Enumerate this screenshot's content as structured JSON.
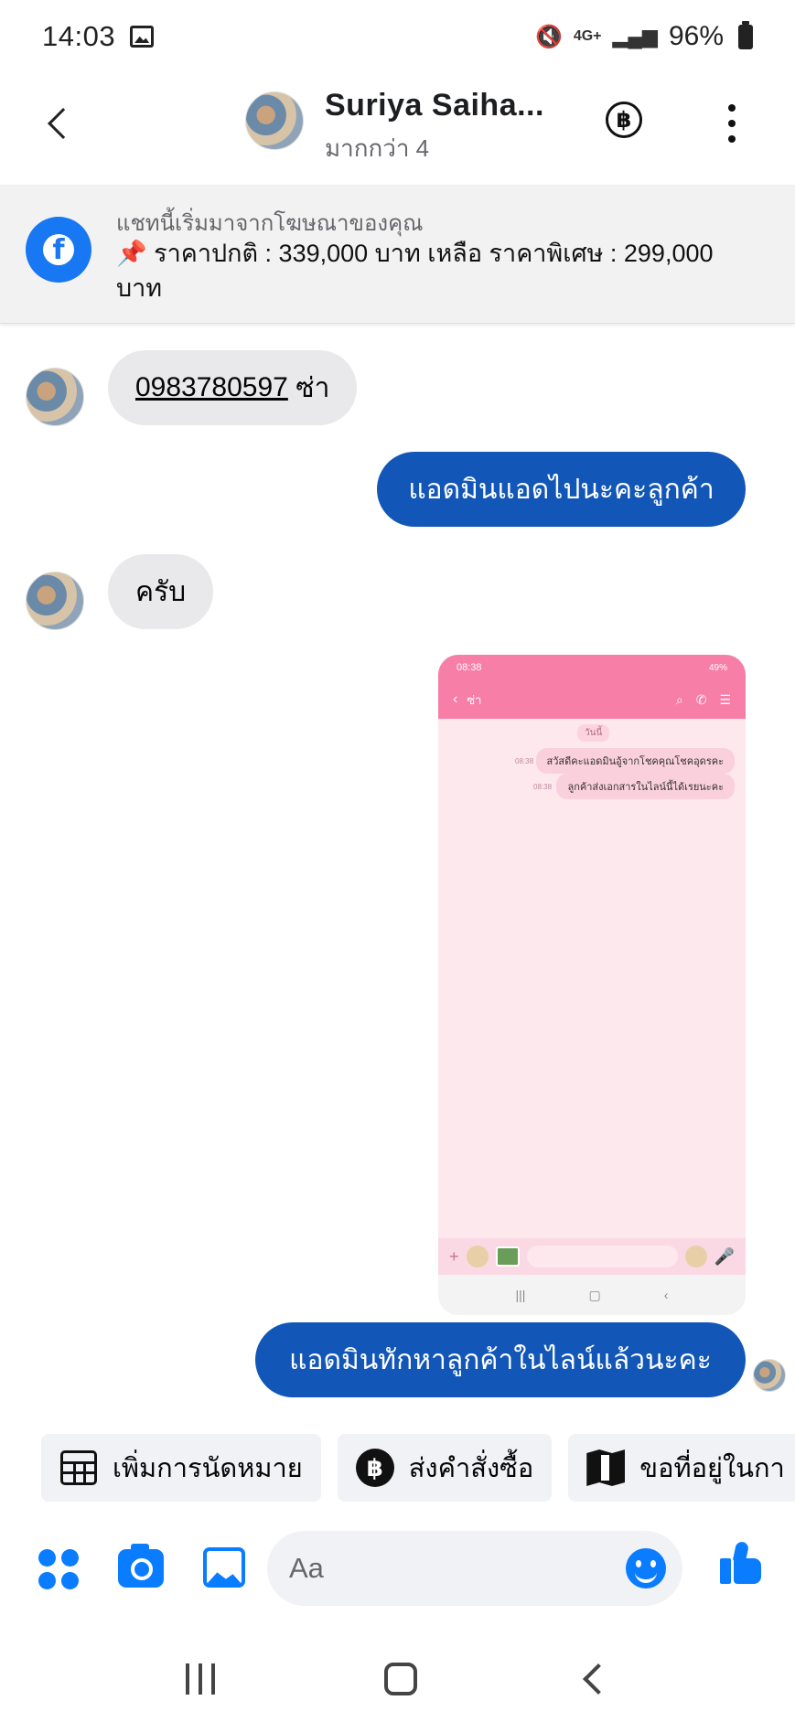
{
  "status_bar": {
    "time": "14:03",
    "network": "4G+",
    "battery": "96%"
  },
  "header": {
    "name": "Suriya Saiha...",
    "subtitle": "มากกว่า 4",
    "baht_symbol": "฿"
  },
  "ad": {
    "caption": "แชทนี้เริ่มมาจากโฆษณาของคุณ",
    "pin": "📌",
    "text": "ราคาปกติ : 339,000 บาท เหลือ ราคาพิเศษ : 299,000 บาท"
  },
  "messages": {
    "m1_phone": "0983780597",
    "m1_rest": "ซ่า",
    "m2": "แอดมินแอดไปนะคะลูกค้า",
    "m3": "ครับ",
    "m4": "แอดมินทักหาลูกค้าในไลน์แล้วนะคะ"
  },
  "screenshot": {
    "time": "08:38",
    "battery": "49%",
    "chat_name": "ซ่า",
    "date_chip": "วันนี้",
    "msg1": "สวัสดีคะแอดมินอู้จากโชคคุณโชคอุดรคะ",
    "msg1_time": "08:38",
    "msg2": "ลูกค้าส่งเอกสารในไลน์นี้ได้เรยนะคะ",
    "msg2_time": "08:38"
  },
  "quick_replies": [
    {
      "label": "เพิ่มการนัดหมาย",
      "icon": "calendar-icon"
    },
    {
      "label": "ส่งคำสั่งซื้อ",
      "icon": "baht-icon"
    },
    {
      "label": "ขอที่อยู่ในกา",
      "icon": "map-icon"
    }
  ],
  "composer": {
    "placeholder": "Aa"
  },
  "colors": {
    "outgoing_bubble": "#1257b8",
    "incoming_bubble": "#e9e9eb",
    "accent": "#0a7cff",
    "facebook_blue": "#1877f2"
  }
}
